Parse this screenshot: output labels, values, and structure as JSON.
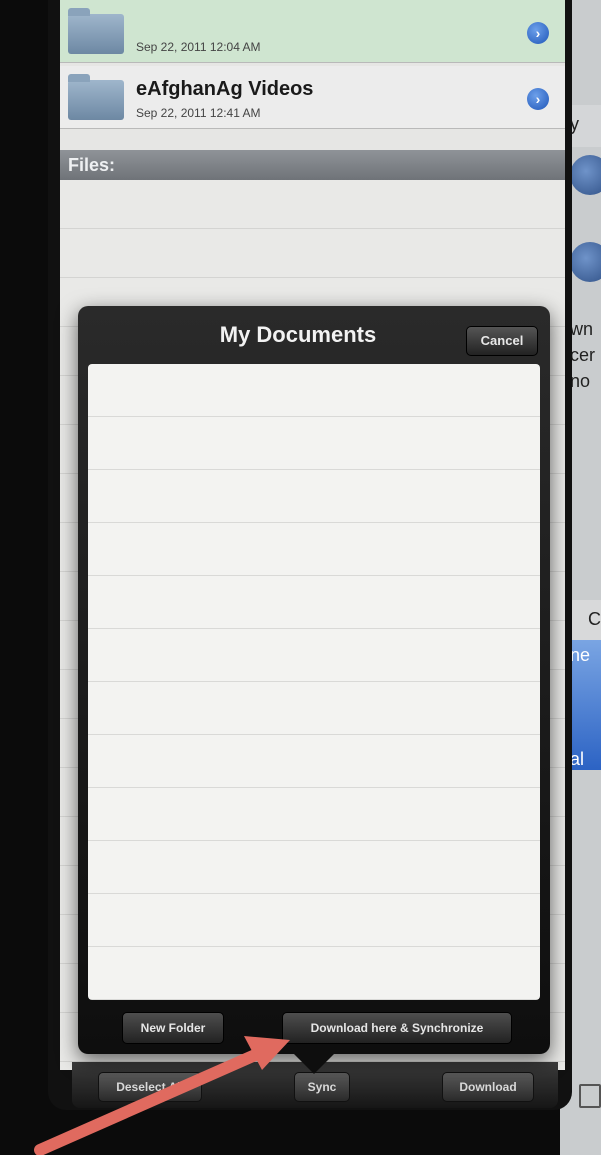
{
  "folders": [
    {
      "title": "",
      "date": "Sep 22, 2011 12:04 AM"
    },
    {
      "title": "eAfghanAg Videos",
      "date": "Sep 22, 2011 12:41 AM"
    }
  ],
  "section": {
    "files_label": "Files:"
  },
  "popover": {
    "title": "My Documents",
    "cancel_label": "Cancel",
    "new_folder_label": "New Folder",
    "download_sync_label": "Download here & Synchronize"
  },
  "toolbar": {
    "deselect_label": "Deselect All",
    "sync_label": "Sync",
    "download_label": "Download"
  },
  "background_app": {
    "fragments": [
      "y",
      "wn",
      "cer",
      "no",
      "C",
      "ne",
      "al"
    ]
  },
  "colors": {
    "selected_row": "#cfe5d0",
    "section_header": "#7a7e83",
    "popover_bg": "#141414",
    "annotation_arrow": "#e06a5f"
  }
}
